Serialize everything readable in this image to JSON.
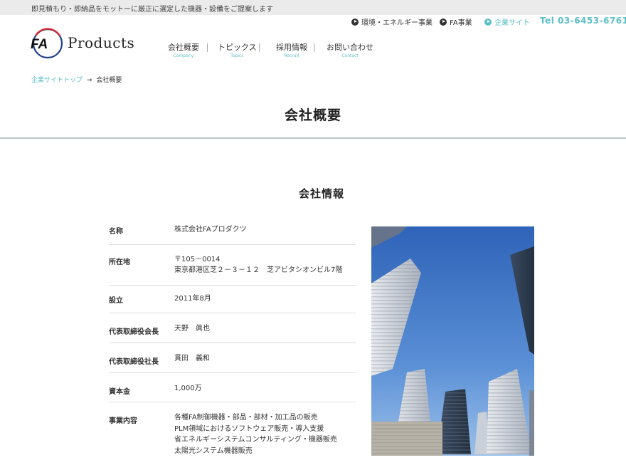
{
  "topbar": {
    "tagline": "即見積もり・即納品をモットーに厳正に選定した機器・設備をご提案します"
  },
  "logo": {
    "mark_text": "FA",
    "wordmark": "Products"
  },
  "util_nav": {
    "items": [
      {
        "label": "環境・エネルギー事業",
        "active": false
      },
      {
        "label": "FA事業",
        "active": false
      },
      {
        "label": "企業サイト",
        "active": true
      }
    ],
    "tel": "Tel 03-6453-6761"
  },
  "main_nav": {
    "items": [
      {
        "label": "会社概要",
        "sub": "Company"
      },
      {
        "label": "トピックス",
        "sub": "Topics"
      },
      {
        "label": "採用情報",
        "sub": "Recruit"
      },
      {
        "label": "お問い合わせ",
        "sub": "Contact"
      }
    ]
  },
  "breadcrumb": {
    "home": "企業サイトトップ",
    "separator": "→",
    "current": "会社概要"
  },
  "page": {
    "title": "会社概要",
    "section_title": "会社情報"
  },
  "company_info": [
    {
      "label": "名称",
      "lines": [
        "株式会社FAプロダクツ"
      ]
    },
    {
      "label": "所在地",
      "lines": [
        "〒105－0014",
        "東京都港区芝２－３－１２　芝アビタシオンビル7階"
      ]
    },
    {
      "label": "設立",
      "lines": [
        "2011年8月"
      ]
    },
    {
      "label": "代表取締役会長",
      "lines": [
        "天野　眞也"
      ]
    },
    {
      "label": "代表取締役社長",
      "lines": [
        "貫田　義和"
      ]
    },
    {
      "label": "資本金",
      "lines": [
        "1,000万"
      ]
    },
    {
      "label": "事業内容",
      "lines": [
        "各種FA制御機器・部品・部材・加工品の販売",
        "PLM領域におけるソフトウェア販売・導入支援",
        "省エネルギーシステムコンサルティング・機器販売",
        "太陽光システム機器販売"
      ]
    }
  ],
  "colors": {
    "accent": "#5bbfc7",
    "topbar_bg": "#ebebeb",
    "logo_red": "#d8232a",
    "logo_blue": "#1f3f8f"
  },
  "icons": {
    "util_link": "circle-arrow-icon"
  },
  "photo": {
    "subject": "skyscrapers-photo"
  }
}
